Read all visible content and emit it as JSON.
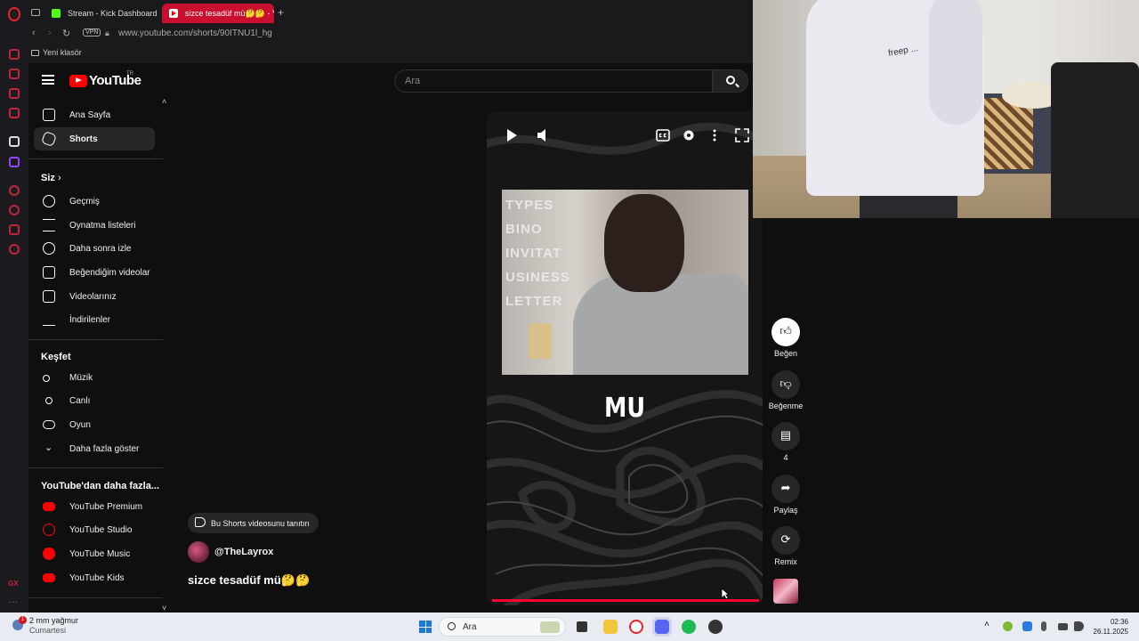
{
  "browser": {
    "tabs": [
      {
        "label": "Stream - Kick Dashboard"
      },
      {
        "label": "sizce tesadüf mü🤔🤔 - Y"
      }
    ],
    "vpn_label": "VPN",
    "url": "www.youtube.com/shorts/90ITNU1l_hg",
    "bookmark": "Yeni klasör",
    "sidebar_label": "GX",
    "sidebar_more": "···"
  },
  "youtube": {
    "logo_text": "YouTube",
    "country": "TR",
    "search_placeholder": "Ara",
    "nav_main": [
      {
        "label": "Ana Sayfa",
        "icon": "home-icon"
      },
      {
        "label": "Shorts",
        "icon": "shorts-icon"
      }
    ],
    "you_heading": "Siz",
    "you_items": [
      {
        "label": "Geçmiş",
        "icon": "history-icon"
      },
      {
        "label": "Oynatma listeleri",
        "icon": "playlist-icon"
      },
      {
        "label": "Daha sonra izle",
        "icon": "watch-later-icon"
      },
      {
        "label": "Beğendiğim videolar",
        "icon": "like-icon"
      },
      {
        "label": "Videolarınız",
        "icon": "your-videos-icon"
      },
      {
        "label": "İndirilenler",
        "icon": "download-icon"
      }
    ],
    "explore_heading": "Keşfet",
    "explore_items": [
      {
        "label": "Müzik",
        "icon": "music-icon"
      },
      {
        "label": "Canlı",
        "icon": "live-icon"
      },
      {
        "label": "Oyun",
        "icon": "gaming-icon"
      },
      {
        "label": "Daha fazla göster",
        "icon": "chevron-down-icon"
      }
    ],
    "more_heading": "YouTube'dan daha fazla...",
    "more_items": [
      {
        "label": "YouTube Premium"
      },
      {
        "label": "YouTube Studio"
      },
      {
        "label": "YouTube Music"
      },
      {
        "label": "YouTube Kids"
      }
    ]
  },
  "short": {
    "clip_overlay_text": "TYPES\nBINO\nINVITAT\nUSINESS\nLETTER",
    "caption": "MU",
    "progress": 1.0,
    "promote_label": "Bu Shorts videosunu tanıtın",
    "channel": "@TheLayrox",
    "title": "sizce tesadüf mü🤔🤔",
    "actions": {
      "like": "Beğen",
      "dislike": "Beğenme",
      "comments": "4",
      "share": "Paylaş",
      "remix": "Remix"
    }
  },
  "webcam": {
    "hoodie_print": "freep ..."
  },
  "taskbar": {
    "weather_badge": "1",
    "weather_temp": "2 mm yağmur",
    "weather_day": "Cumartesi",
    "search_label": "Ara",
    "time": "02:36",
    "date": "26.11.2025"
  },
  "colors": {
    "yt_red": "#ff0000",
    "opera_red": "#c8102e",
    "progress": "#ff0033"
  }
}
